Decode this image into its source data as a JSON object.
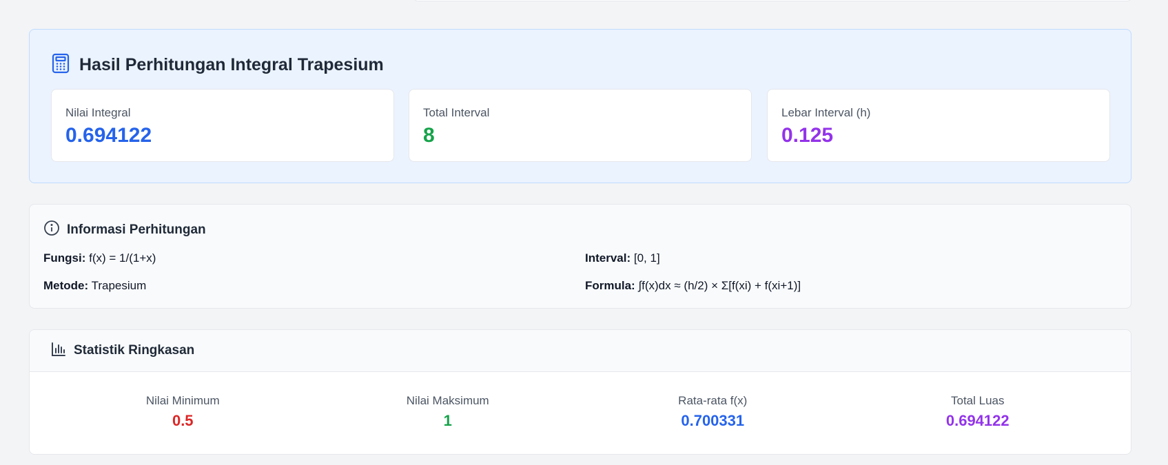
{
  "result": {
    "title": "Hasil Perhitungan Integral Trapesium",
    "icon": "calculator-icon",
    "stats": [
      {
        "label": "Nilai Integral",
        "value": "0.694122",
        "color": "#2563eb"
      },
      {
        "label": "Total Interval",
        "value": "8",
        "color": "#16a34a"
      },
      {
        "label": "Lebar Interval (h)",
        "value": "0.125",
        "color": "#9333ea"
      }
    ]
  },
  "info": {
    "title": "Informasi Perhitungan",
    "icon": "info-icon",
    "fungsi_label": "Fungsi:",
    "fungsi_value": "f(x) = 1/(1+x)",
    "interval_label": "Interval:",
    "interval_value": "[0, 1]",
    "metode_label": "Metode:",
    "metode_value": "Trapesium",
    "formula_label": "Formula:",
    "formula_value": "∫f(x)dx ≈ (h/2) × Σ[f(xi) + f(xi+1)]"
  },
  "summary": {
    "title": "Statistik Ringkasan",
    "icon": "bar-chart-icon",
    "items": [
      {
        "label": "Nilai Minimum",
        "value": "0.5",
        "color": "#dc2626"
      },
      {
        "label": "Nilai Maksimum",
        "value": "1",
        "color": "#16a34a"
      },
      {
        "label": "Rata-rata f(x)",
        "value": "0.700331",
        "color": "#2563eb"
      },
      {
        "label": "Total Luas",
        "value": "0.694122",
        "color": "#9333ea"
      }
    ]
  }
}
